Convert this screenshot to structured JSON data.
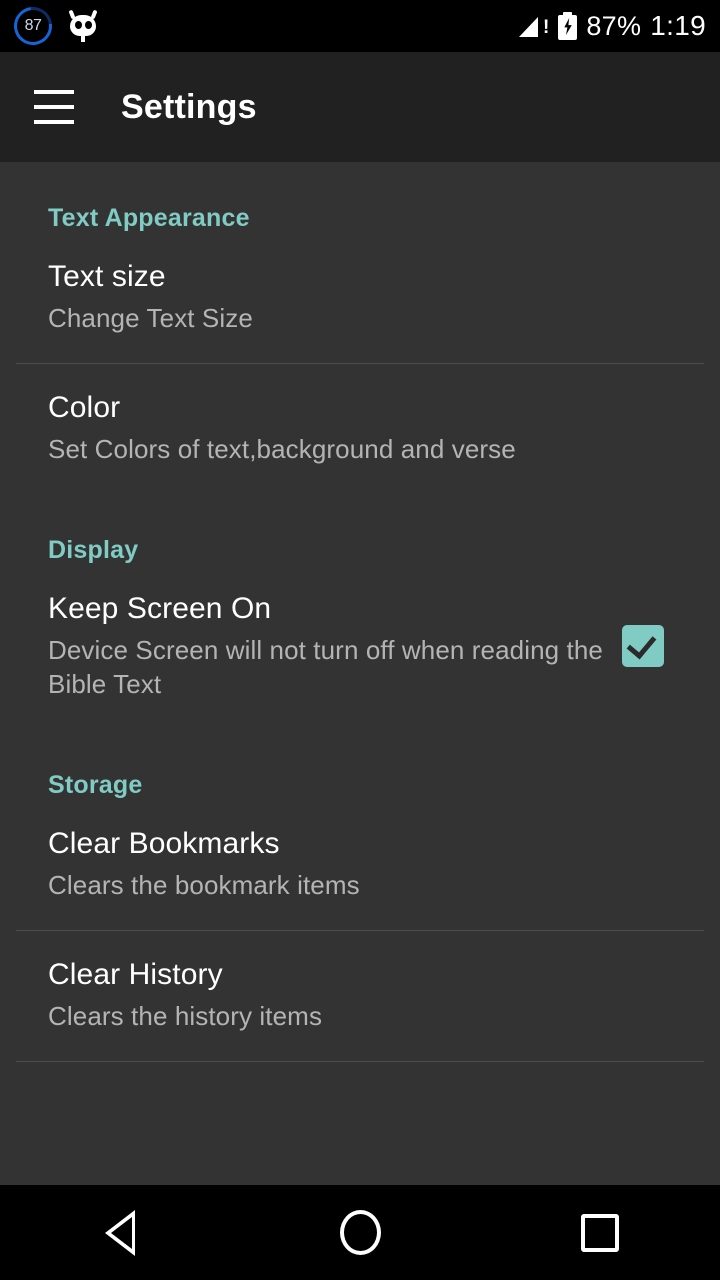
{
  "status_bar": {
    "battery_ring_value": "87",
    "battery_percent": "87%",
    "time": "1:19",
    "icons": [
      "battery-ring-icon",
      "cyanogenmod-icon",
      "signal-warning-icon",
      "battery-charging-icon"
    ]
  },
  "app_bar": {
    "menu_icon": "hamburger-menu-icon",
    "title": "Settings"
  },
  "sections": [
    {
      "header": "Text Appearance",
      "items": [
        {
          "title": "Text size",
          "summary": "Change Text Size",
          "has_checkbox": false,
          "divider_after": true
        },
        {
          "title": "Color",
          "summary": "Set Colors of text,background and verse",
          "has_checkbox": false,
          "divider_after": false
        }
      ]
    },
    {
      "header": "Display",
      "items": [
        {
          "title": "Keep Screen On",
          "summary": "Device Screen will not turn off when reading the Bible Text",
          "has_checkbox": true,
          "checked": true,
          "divider_after": false
        }
      ]
    },
    {
      "header": "Storage",
      "items": [
        {
          "title": "Clear Bookmarks",
          "summary": "Clears the bookmark items",
          "has_checkbox": false,
          "divider_after": true
        },
        {
          "title": "Clear History",
          "summary": "Clears the history items",
          "has_checkbox": false,
          "divider_after": true
        }
      ]
    }
  ],
  "nav_bar": {
    "back": "back-nav-button",
    "home": "home-nav-button",
    "recents": "recents-nav-button"
  },
  "colors": {
    "accent": "#80cbc4",
    "app_bar_bg": "#212121",
    "content_bg": "#333333",
    "status_bar_bg": "#000000",
    "title_text": "#ffffff",
    "summary_text": "#b4b4b4",
    "divider": "#4d4d4d"
  }
}
